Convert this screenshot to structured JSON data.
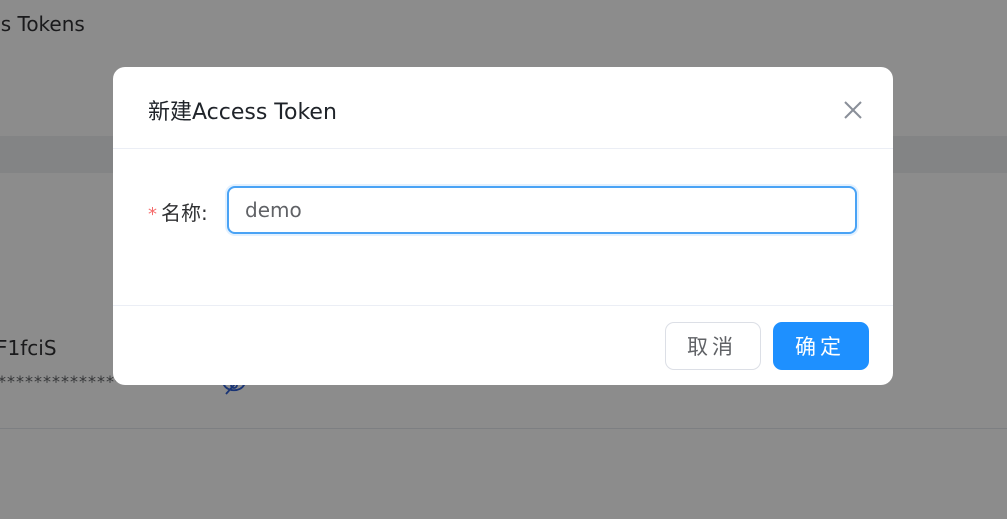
{
  "background": {
    "page_title": "ess Tokens",
    "token_name_partial": "F1fciS",
    "token_masked_partial": "************************"
  },
  "dialog": {
    "title": "新建Access Token",
    "form": {
      "name_label": "名称:",
      "required_mark": "*",
      "name_value": "demo"
    },
    "buttons": {
      "cancel_label": "取消",
      "confirm_label": "确定"
    }
  },
  "icons": {
    "close": "close-icon",
    "eye": "eye-slash-icon"
  },
  "colors": {
    "primary": "#1e90ff",
    "required": "#f56c6c",
    "input_focus_border": "#4aa3f5"
  }
}
